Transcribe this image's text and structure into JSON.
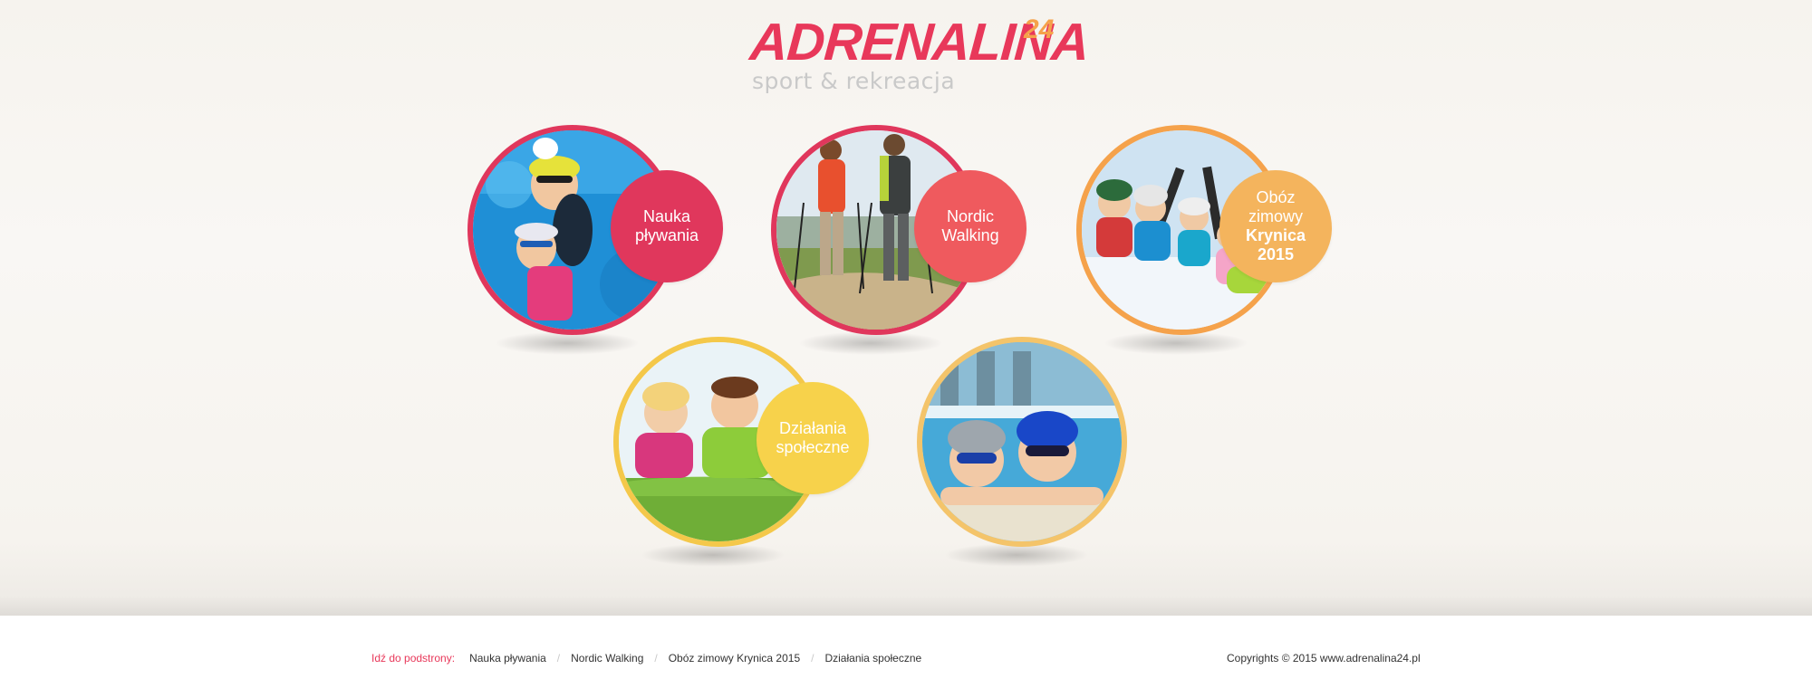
{
  "brand": {
    "name": "ADRENALINA",
    "suffix": "24",
    "tagline": "sport & rekreacja"
  },
  "tiles": [
    {
      "id": "nauka",
      "lines": [
        "Nauka",
        "pływania"
      ],
      "color": "#e0375c",
      "ring": "#e0375c",
      "photo": "swimming-kids-photo"
    },
    {
      "id": "nordic",
      "lines": [
        "Nordic",
        "Walking"
      ],
      "color": "#ef5a5e",
      "ring": "#e0375c",
      "photo": "nordic-walking-couple-photo"
    },
    {
      "id": "oboz",
      "lines": [
        "Obóz",
        "zimowy"
      ],
      "bold_lines": [
        "Krynica",
        "2015"
      ],
      "color": "#f4b45d",
      "ring": "#f5a24b",
      "photo": "ski-group-photo"
    },
    {
      "id": "dzialania",
      "lines": [
        "Działania",
        "społeczne"
      ],
      "color": "#f7d24b",
      "ring": "#f4c84a",
      "photo": "kids-on-grass-photo"
    },
    {
      "id": "pool",
      "color": "#f4c46a",
      "ring": "#f4c46a",
      "photo": "kids-in-pool-photo"
    }
  ],
  "footer": {
    "lead": "Idź do podstrony:",
    "links": [
      "Nauka pływania",
      "Nordic Walking",
      "Obóz zimowy Krynica 2015",
      "Działania społeczne"
    ],
    "copyright": "Copyrights © 2015 www.adrenalina24.pl"
  }
}
